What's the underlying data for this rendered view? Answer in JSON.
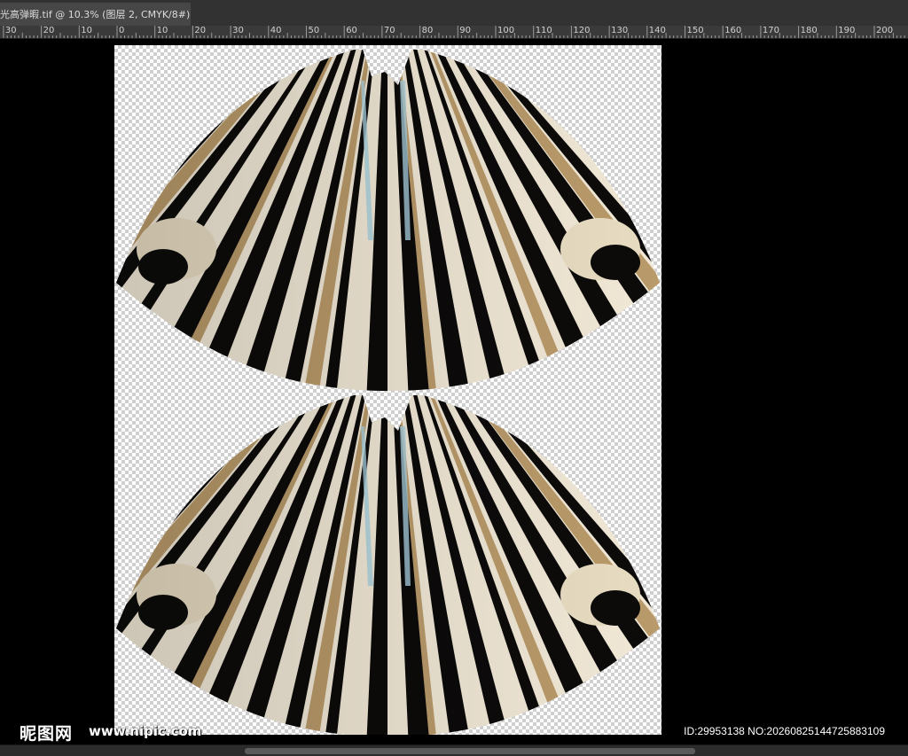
{
  "document_tab": {
    "title": "光高弹暇.tif @ 10.3% (图层 2, CMYK/8#) *",
    "close_glyph": "×"
  },
  "ruler": {
    "labels": [
      "30",
      "20",
      "10",
      "0",
      "10",
      "20",
      "30",
      "40",
      "50",
      "60",
      "70",
      "80",
      "90",
      "100",
      "110",
      "120",
      "130",
      "140",
      "150",
      "160",
      "170",
      "180",
      "190",
      "200"
    ]
  },
  "watermark": {
    "logo": "昵图网",
    "site": "www.nipic.com",
    "id_text": "ID:29953138 NO:20260825144725883109"
  },
  "colors": {
    "stripe_dark": "#0c0b0a",
    "stripe_cream": "#f1e8d6",
    "stripe_tan": "#b99a6a",
    "stripe_blue": "#a9d0de",
    "workspace": "#000000",
    "panel": "#323232"
  }
}
